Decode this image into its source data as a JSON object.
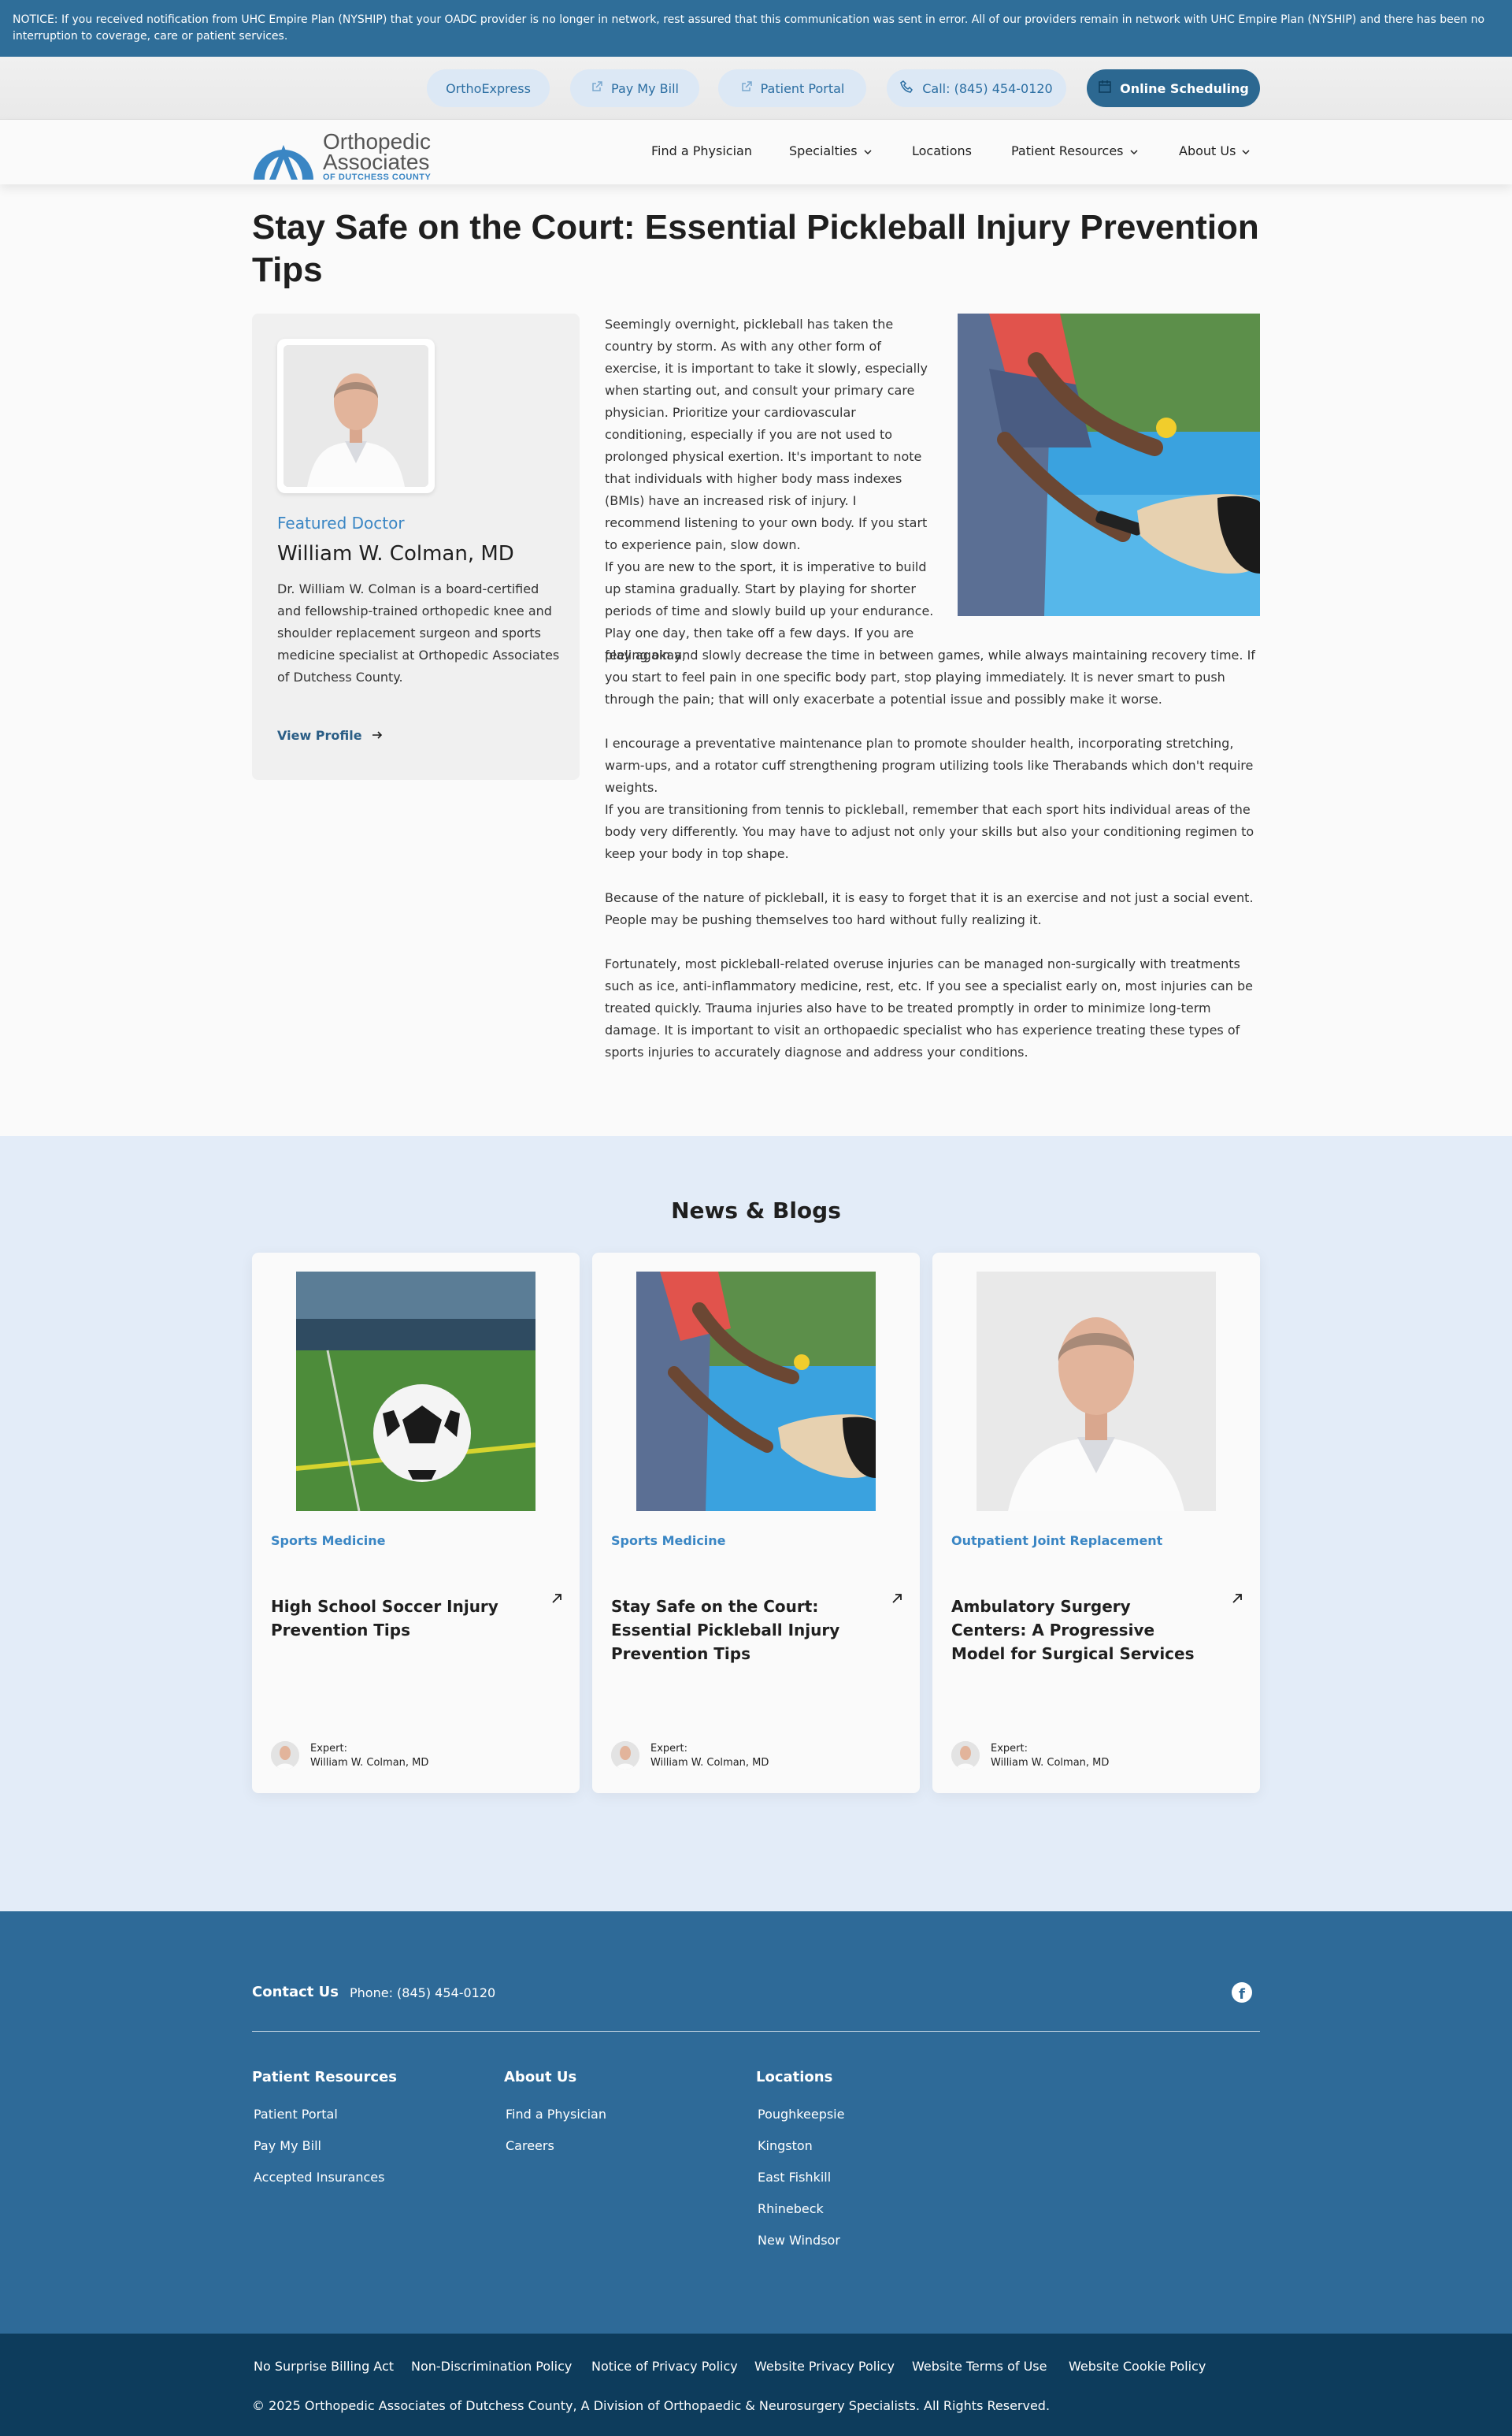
{
  "notice": "NOTICE: If you received notification from UHC Empire Plan (NYSHIP) that your OADC provider is no longer in network, rest assured that this communication was sent in error. All of our providers remain in network with UHC Empire Plan (NYSHIP) and there has been no interruption to coverage, care or patient services.",
  "utility": {
    "orthoexpress": "OrthoExpress",
    "pay_bill": "Pay My Bill",
    "portal": "Patient Portal",
    "call": "Call: (845) 454-0120",
    "scheduling": "Online Scheduling"
  },
  "logo": {
    "line1": "Orthopedic",
    "line2": "Associates",
    "line3": "OF DUTCHESS COUNTY"
  },
  "nav": {
    "find_physician": "Find a Physician",
    "specialties": "Specialties",
    "locations": "Locations",
    "patient_resources": "Patient Resources",
    "about": "About Us"
  },
  "article": {
    "title": "Stay Safe on the Court: Essential Pickleball Injury Prevention Tips",
    "p1": "Seemingly overnight, pickleball has taken the country by storm. As with any other form of exercise, it is important to take it slowly, especially when starting out, and consult your primary care physician. Prioritize your cardiovascular conditioning, especially if you are not used to prolonged physical exertion. It's important to note that individuals with higher body mass indexes (BMIs) have an increased risk of injury. I recommend listening to your own body. If you start to experience pain, slow down.",
    "p2a": "If you are new to the sport, it is imperative to build up stamina gradually. Start by playing for shorter periods of time and slowly build up your endurance. Play one day, then take off a few days. If you are feeling okay,",
    "p2b": "play again and slowly decrease the time in between games, while always maintaining recovery time. If you start to feel pain in one specific body part, stop playing immediately. It is never smart to push through the pain; that will only exacerbate a potential issue and possibly make it worse.",
    "p3": "I encourage a preventative maintenance plan to promote shoulder health, incorporating stretching, warm-ups, and a rotator cuff strengthening program utilizing tools like Therabands which don't require weights.",
    "p4": "If you are transitioning from tennis to pickleball, remember that each sport hits individual areas of the body very differently. You may have to adjust not only your skills but also your conditioning regimen to keep your body in top shape.",
    "p5": "Because of the nature of pickleball, it is easy to forget that it is an exercise and not just a social event. People may be pushing themselves too hard without fully realizing it.",
    "p6": "Fortunately, most pickleball-related overuse injuries can be managed non-surgically with treatments such as ice, anti-inflammatory medicine, rest, etc. If you see a specialist early on, most injuries can be treated quickly. Trauma injuries also have to be treated promptly in order to minimize long-term damage. It is important to visit an orthopaedic specialist who has experience treating these types of sports injuries to accurately diagnose and address your conditions."
  },
  "doctor": {
    "featured_label": "Featured Doctor",
    "name": "William W. Colman, MD",
    "bio": "Dr. William W. Colman is a board-certified and fellowship-trained orthopedic knee and shoulder replacement surgeon and sports medicine specialist at Orthopedic Associates of Dutchess County.",
    "view_profile": "View Profile"
  },
  "news": {
    "title": "News & Blogs",
    "expert_label": "Expert:",
    "cards": [
      {
        "category": "Sports Medicine",
        "title": "High School Soccer Injury Prevention Tips",
        "expert": "William W. Colman, MD"
      },
      {
        "category": "Sports Medicine",
        "title": "Stay Safe on the Court: Essential Pickleball Injury Prevention Tips",
        "expert": "William W. Colman, MD"
      },
      {
        "category": "Outpatient Joint Replacement",
        "title": "Ambulatory Surgery Centers: A Progressive Model for Surgical Services",
        "expert": "William W. Colman, MD"
      }
    ]
  },
  "footer": {
    "contact_label": "Contact Us",
    "phone": "Phone: (845) 454-0120",
    "patient_resources": {
      "title": "Patient Resources",
      "links": [
        "Patient Portal",
        "Pay My Bill",
        "Accepted Insurances"
      ]
    },
    "about": {
      "title": "About Us",
      "links": [
        "Find a Physician",
        "Careers"
      ]
    },
    "locations": {
      "title": "Locations",
      "links": [
        "Poughkeepsie",
        "Kingston",
        "East Fishkill",
        "Rhinebeck",
        "New Windsor"
      ]
    }
  },
  "legal": {
    "links": [
      "No Surprise Billing Act",
      "Non-Discrimination Policy",
      "Notice of Privacy Policy",
      "Website Privacy Policy",
      "Website Terms of Use",
      "Website Cookie Policy"
    ],
    "copyright": "© 2025 Orthopedic Associates of Dutchess County, A Division of Orthopaedic & Neurosurgery Specialists. All Rights Reserved."
  },
  "colors": {
    "brand_blue": "#2e6a98",
    "accent_blue": "#3a86c4",
    "dark_footer": "#0d3c5c",
    "news_bg": "#e3ecf8"
  },
  "icons": {
    "external": "external-link-icon",
    "phone": "phone-icon",
    "calendar": "calendar-icon",
    "chevron": "chevron-down-icon",
    "arrow_right": "arrow-right-icon",
    "arrow_up_right": "arrow-up-right-icon",
    "facebook": "facebook-icon"
  }
}
